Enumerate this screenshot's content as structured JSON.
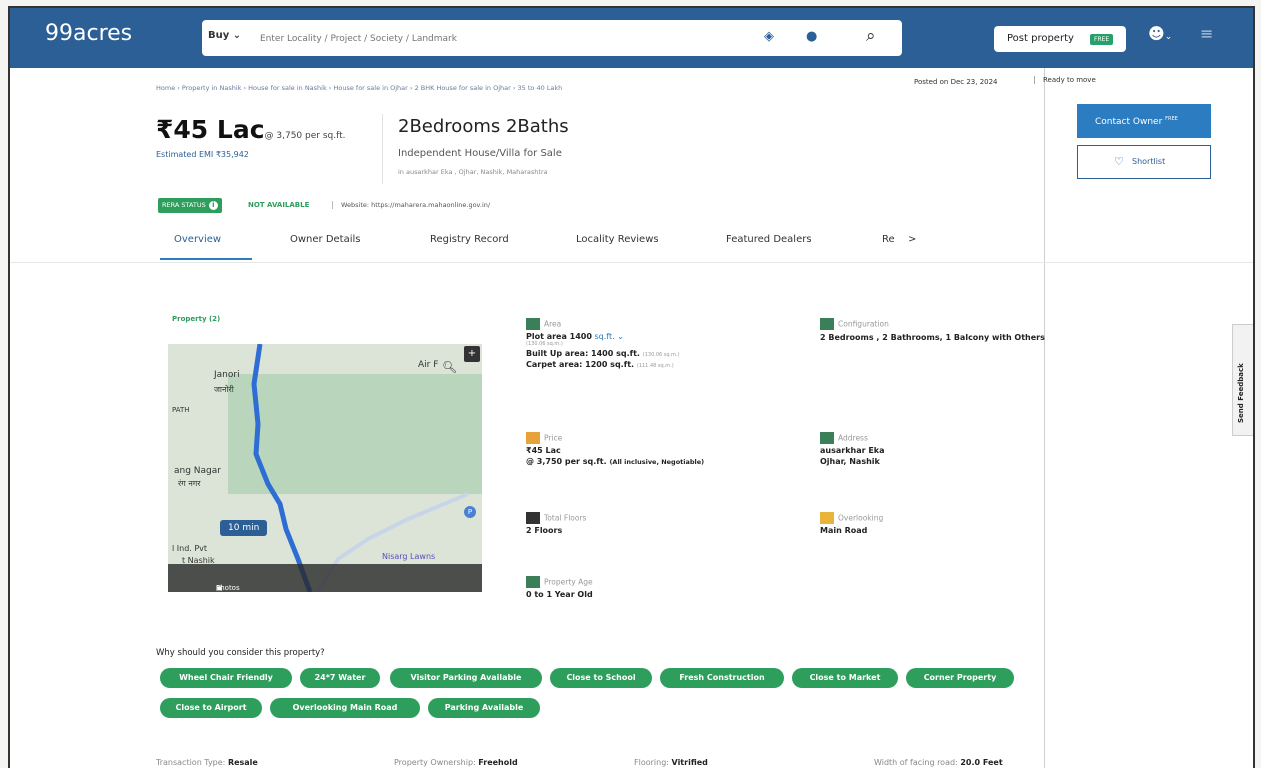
{
  "header": {
    "logo": "99acres",
    "search_mode": "Buy",
    "search_placeholder": "Enter Locality / Project / Society / Landmark",
    "post_property": "Post property",
    "post_badge": "FREE"
  },
  "breadcrumb": "Home › Property in Nashik › House for sale in Nashik › House for sale in Ojhar › 2 BHK House for sale in Ojhar › 35 to 40 Lakh",
  "posted": "Posted on Dec 23, 2024",
  "status": "Ready to move",
  "listing": {
    "price": "₹45 Lac",
    "price_per_sqft": "@ 3,750 per sq.ft.",
    "emi": "Estimated EMI ₹35,942",
    "title": "2Bedrooms 2Baths",
    "kind": "Independent House/Villa for Sale",
    "address": "in ausarkhar Eka , Ojhar, Nashik, Maharashtra"
  },
  "actions": {
    "contact": "Contact Owner",
    "contact_badge": "FREE",
    "shortlist": "Shortlist"
  },
  "rera": {
    "label": "RERA STATUS",
    "value": "NOT AVAILABLE",
    "website": "Website: https://maharera.mahaonline.gov.in/"
  },
  "tabs": [
    "Overview",
    "Owner Details",
    "Registry Record",
    "Locality Reviews",
    "Featured Dealers",
    "Re"
  ],
  "tab_next": ">",
  "property_count": "Property (2)",
  "map": {
    "labels": [
      "Janori",
      "जानोरी",
      "PATH",
      "Air F",
      "ang Nagar",
      "रंग नगर",
      "l Ind. Pvt",
      "t Nashik",
      "Nisarg Lawns"
    ],
    "time": "10 min",
    "photos": "Photos (1/2)"
  },
  "facts": {
    "area": {
      "label": "Area",
      "plot": "Plot area 1400",
      "unit": "sq.ft.",
      "plot_sqm": "(130.06 sq.m.)",
      "built": "Built Up area: 1400 sq.ft.",
      "built_sqm": "(130.06 sq.m.)",
      "carpet": "Carpet area: 1200 sq.ft.",
      "carpet_sqm": "(111.48 sq.m.)"
    },
    "configuration": {
      "label": "Configuration",
      "value": "2 Bedrooms , 2 Bathrooms, 1 Balcony with Others"
    },
    "price": {
      "label": "Price",
      "value": "₹45 Lac",
      "per": "@ 3,750 per sq.ft.",
      "note": "(All inclusive, Negotiable)"
    },
    "address": {
      "label": "Address",
      "line1": "ausarkhar Eka",
      "line2": "Ojhar, Nashik"
    },
    "floors": {
      "label": "Total Floors",
      "value": "2 Floors"
    },
    "overlooking": {
      "label": "Overlooking",
      "value": "Main Road"
    },
    "age": {
      "label": "Property Age",
      "value": "0 to 1 Year Old"
    }
  },
  "why": "Why should you consider this property?",
  "chips": [
    "Wheel Chair Friendly",
    "24*7 Water",
    "Visitor Parking Available",
    "Close to School",
    "Fresh Construction",
    "Close to Market",
    "Corner Property",
    "Close to Airport",
    "Overlooking Main Road",
    "Parking Available"
  ],
  "bottom": {
    "transaction_label": "Transaction Type:",
    "transaction_value": "Resale",
    "ownership_label": "Property Ownership:",
    "ownership_value": "Freehold",
    "flooring_label": "Flooring:",
    "flooring_value": "Vitrified",
    "road_label": "Width of facing road:",
    "road_value": "20.0 Feet"
  },
  "feedback": "Send Feedback",
  "colors": {
    "header": "#2b5f95",
    "green": "#2e9e5c",
    "link": "#2b7cc1"
  }
}
